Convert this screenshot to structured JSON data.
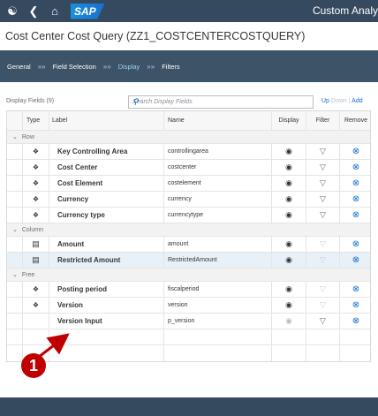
{
  "shell": {
    "title": "Custom Analy",
    "logo": "SAP"
  },
  "page_title": "Cost Center Cost Query (ZZ1_COSTCENTERCOSTQUERY)",
  "wizard": [
    {
      "label": "General",
      "active": false
    },
    {
      "label": "Field Selection",
      "active": false
    },
    {
      "label": "Display",
      "active": true
    },
    {
      "label": "Filters",
      "active": false
    }
  ],
  "toolbar": {
    "fields_count": "Display Fields (9)",
    "search_placeholder": "Search Display Fields",
    "up": "Up",
    "down": "Down",
    "add": "Add"
  },
  "columns": {
    "type": "Type",
    "label": "Label",
    "name": "Name",
    "display": "Display",
    "filter": "Filter",
    "remove": "Remove"
  },
  "groups": {
    "row": "Row",
    "column": "Column",
    "free": "Free"
  },
  "rows": [
    {
      "label": "Key Controlling Area",
      "name": "controllingarea"
    },
    {
      "label": "Cost Center",
      "name": "costcenter"
    },
    {
      "label": "Cost Element",
      "name": "costelement"
    },
    {
      "label": "Currency",
      "name": "currency"
    },
    {
      "label": "Currency type",
      "name": "currencytype"
    },
    {
      "label": "Amount",
      "name": "amount"
    },
    {
      "label": "Restricted Amount",
      "name": "RestrictedAmount"
    },
    {
      "label": "Posting period",
      "name": "fiscalperiod"
    },
    {
      "label": "Version",
      "name": "version"
    },
    {
      "label": "Version Input",
      "name": "p_version"
    }
  ],
  "callout": "1",
  "colors": {
    "shell": "#354a5f",
    "wizard": "#3d5367",
    "accent": "#0a6ed1",
    "callout": "#c00000"
  }
}
